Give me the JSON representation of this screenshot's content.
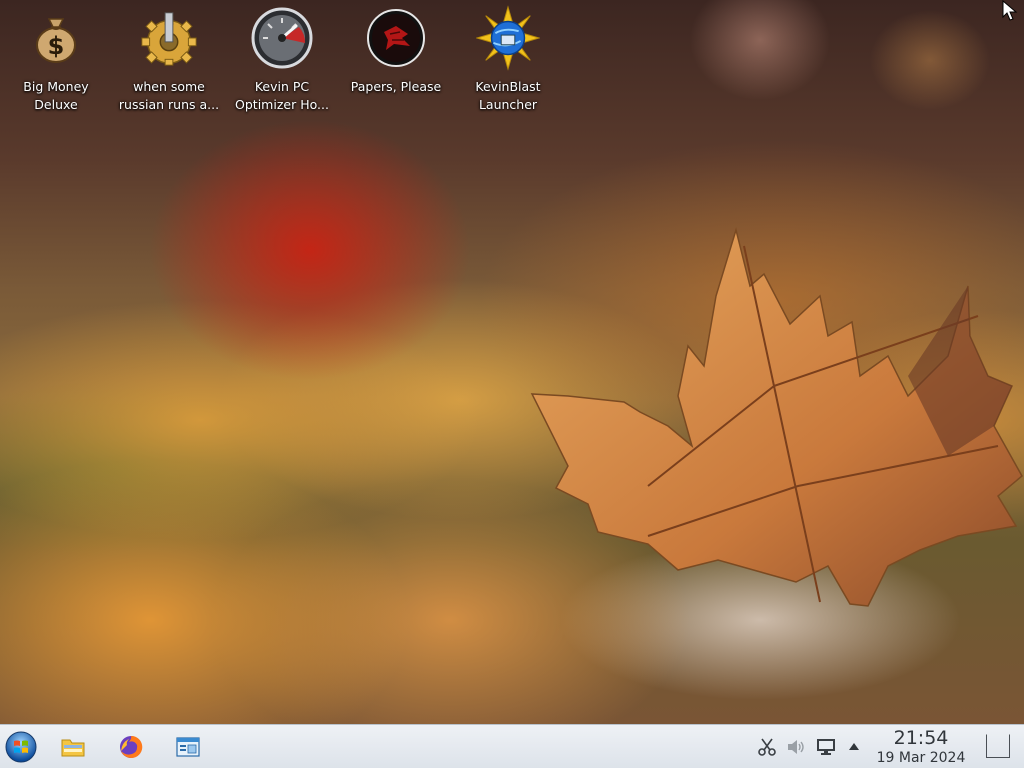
{
  "desktop": {
    "icons": [
      {
        "label": "Big Money\nDeluxe",
        "icon": "money-bag-icon"
      },
      {
        "label": "when some\nrussian runs a...",
        "icon": "gear-icon"
      },
      {
        "label": "Kevin PC\nOptimizer Ho...",
        "icon": "speedometer-icon"
      },
      {
        "label": "Papers, Please",
        "icon": "papers-please-icon"
      },
      {
        "label": "KevinBlast\nLauncher",
        "icon": "sunburst-globe-icon"
      }
    ]
  },
  "taskbar": {
    "launchers": [
      {
        "name": "start-menu-button",
        "icon": "start-orb-icon"
      },
      {
        "name": "file-manager-button",
        "icon": "folder-icon"
      },
      {
        "name": "firefox-button",
        "icon": "firefox-icon"
      },
      {
        "name": "system-settings-button",
        "icon": "settings-window-icon"
      }
    ],
    "tray": [
      {
        "name": "clipboard-tray",
        "icon": "scissors-icon"
      },
      {
        "name": "volume-tray",
        "icon": "speaker-icon"
      },
      {
        "name": "network-tray",
        "icon": "monitor-network-icon"
      },
      {
        "name": "tray-expand",
        "icon": "triangle-up-icon"
      }
    ],
    "clock": {
      "time": "21:54",
      "date": "19 Mar 2024"
    },
    "show_desktop": "show-desktop-icon"
  },
  "colors": {
    "taskbar_bg": "#e4e9ef",
    "label_text": "#ffffff",
    "clock_text": "#31363b"
  }
}
